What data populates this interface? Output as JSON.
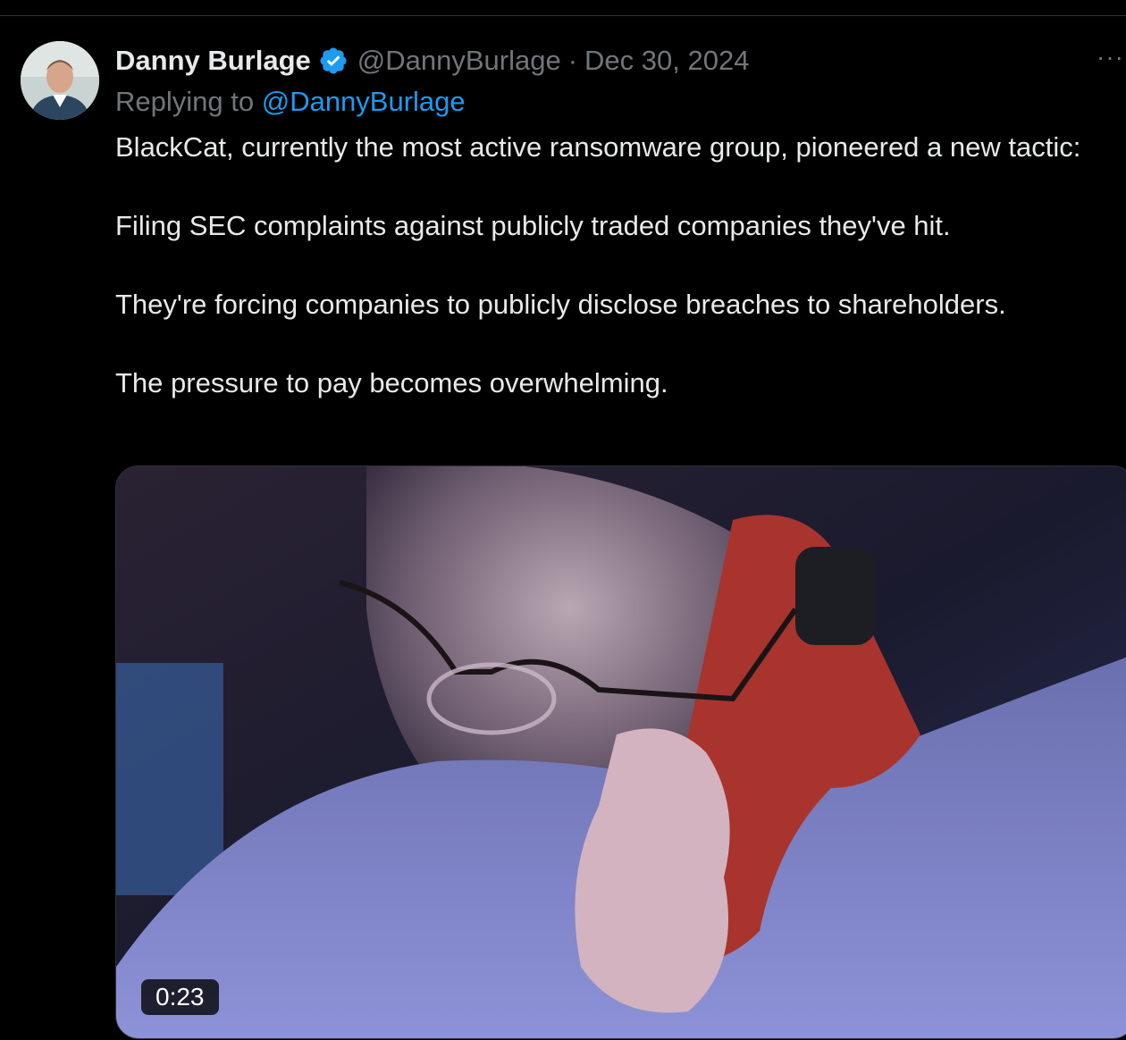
{
  "tweet": {
    "author_name": "Danny Burlage",
    "handle": "@DannyBurlage",
    "separator": "·",
    "date": "Dec 30, 2024",
    "more_label": "···",
    "replying_prefix": "Replying to",
    "replying_to": "@DannyBurlage",
    "paragraphs": [
      "BlackCat, currently the most active ransomware group, pioneered a new tactic:",
      "Filing SEC complaints against publicly traded companies they've hit.",
      "They're forcing companies to publicly disclose breaches to shareholders.",
      "The pressure to pay becomes overwhelming."
    ],
    "video_duration": "0:23"
  },
  "icons": {
    "verified": "verified-badge-icon",
    "more": "more-options-icon"
  },
  "colors": {
    "background": "#000000",
    "text": "#e7e9ea",
    "muted": "#71767b",
    "accent": "#1d9bf0"
  }
}
